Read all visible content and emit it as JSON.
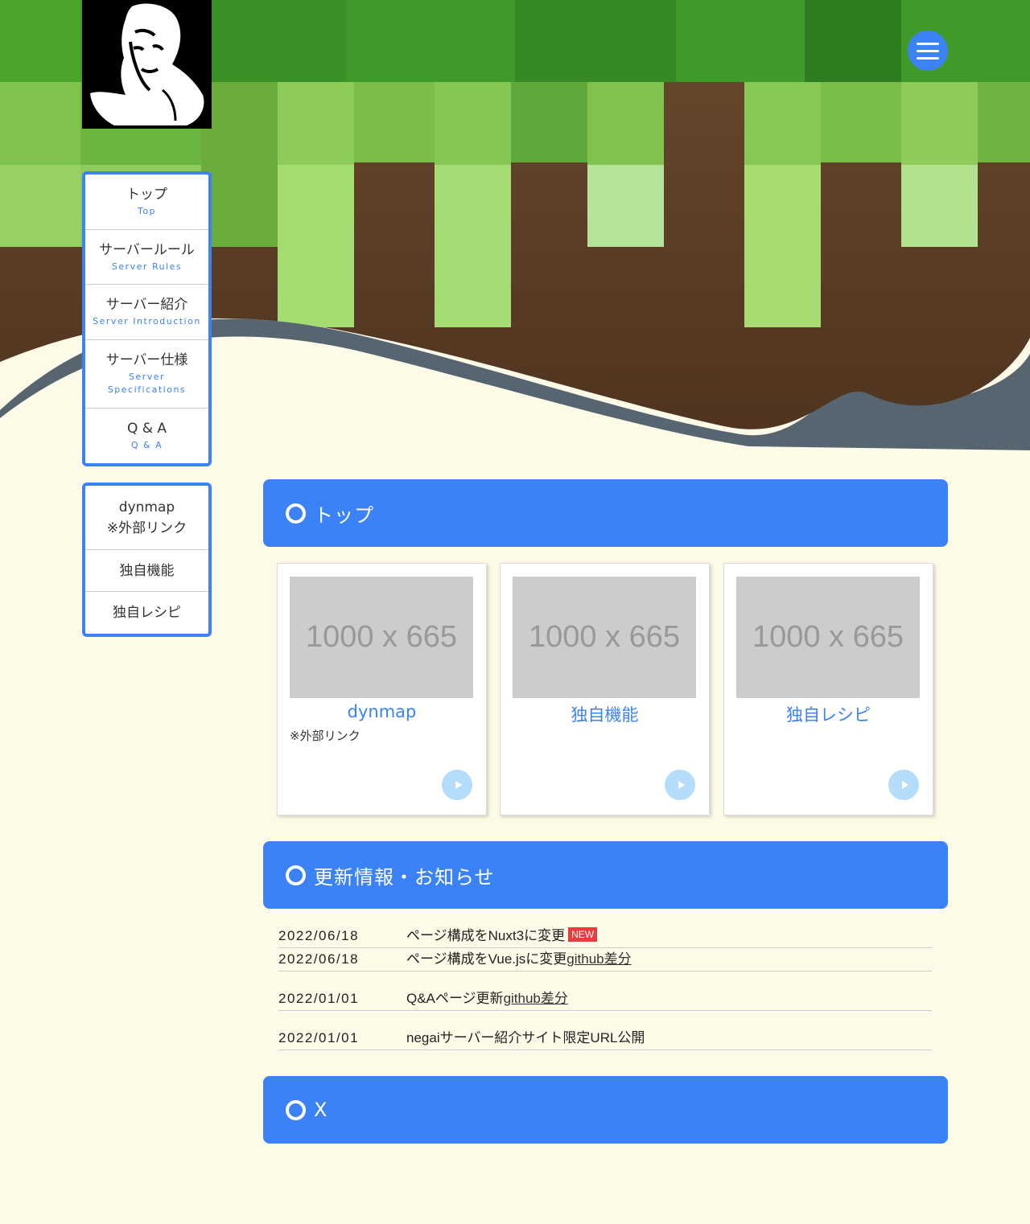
{
  "logo": {
    "icon": "portrait-logo-icon"
  },
  "menu": {
    "icon": "hamburger-icon"
  },
  "nav_main": [
    {
      "jp": "トップ",
      "en": "Top"
    },
    {
      "jp": "サーバールール",
      "en": "Server Rules"
    },
    {
      "jp": "サーバー紹介",
      "en": "Server Introduction"
    },
    {
      "jp": "サーバー仕様",
      "en": "Server Specifications"
    },
    {
      "jp": "Q & A",
      "en": "Q & A"
    }
  ],
  "nav_sub": [
    {
      "line1": "dynmap",
      "line2": "※外部リンク"
    },
    {
      "line1": "独自機能",
      "line2": ""
    },
    {
      "line1": "独自レシピ",
      "line2": ""
    }
  ],
  "sections": {
    "top": "トップ",
    "news": "更新情報・お知らせ",
    "x": "X"
  },
  "cards": [
    {
      "image": "1000 x 665",
      "title": "dynmap",
      "note": "※外部リンク"
    },
    {
      "image": "1000 x 665",
      "title": "独自機能",
      "note": ""
    },
    {
      "image": "1000 x 665",
      "title": "独自レシピ",
      "note": ""
    }
  ],
  "news": [
    {
      "date": "2022/06/18",
      "text": "ページ構成をNuxt3に変更",
      "link": "",
      "badge": "NEW"
    },
    {
      "date": "2022/06/18",
      "text": "ページ構成をVue.jsに変更",
      "link": "github差分",
      "badge": ""
    },
    {
      "date": "2022/01/01",
      "text": "Q&Aページ更新",
      "link": "github差分",
      "badge": ""
    },
    {
      "date": "2022/01/01",
      "text": "negaiサーバー紹介サイト限定URL公開",
      "link": "",
      "badge": ""
    }
  ],
  "colors": {
    "accent": "#3b82f6",
    "background": "#fdfae8",
    "new_badge": "#e53e3e"
  }
}
